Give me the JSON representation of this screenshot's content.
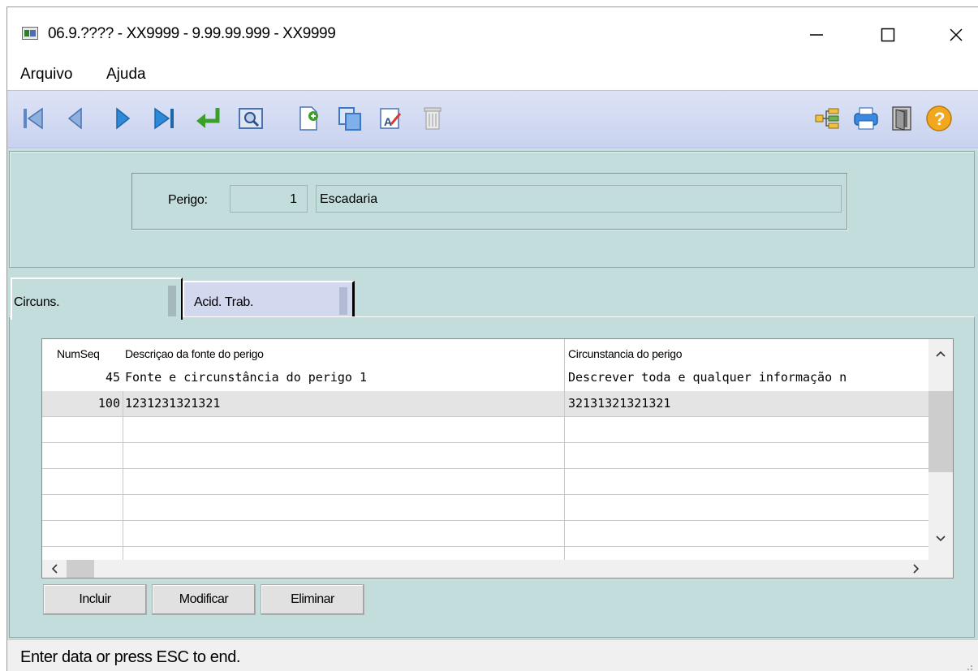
{
  "window": {
    "title": "06.9.???? - XX9999 - 9.99.99.999 - XX9999"
  },
  "menu": {
    "items": [
      {
        "label": "Arquivo"
      },
      {
        "label": "Ajuda"
      }
    ]
  },
  "toolbar": {
    "buttons": [
      {
        "icon": "first-record-icon"
      },
      {
        "icon": "previous-record-icon"
      },
      {
        "icon": "next-record-icon"
      },
      {
        "icon": "last-record-icon"
      },
      {
        "icon": "return-icon"
      },
      {
        "icon": "view-icon"
      },
      {
        "icon": "new-record-icon"
      },
      {
        "icon": "copy-icon"
      },
      {
        "icon": "edit-icon"
      },
      {
        "icon": "delete-icon"
      },
      {
        "icon": "tree-icon"
      },
      {
        "icon": "print-icon"
      },
      {
        "icon": "exit-door-icon"
      },
      {
        "icon": "help-icon"
      }
    ]
  },
  "header": {
    "perigo_label": "Perigo:",
    "perigo_number": "1",
    "perigo_description": "Escadaria"
  },
  "tabs": [
    {
      "label": "Circuns."
    },
    {
      "label": "Acid. Trab."
    }
  ],
  "grid": {
    "columns": [
      "NumSeq",
      "Descriçao da fonte do perigo",
      "Circunstancia do perigo"
    ],
    "rows": [
      {
        "numseq": "45",
        "descricao": "Fonte e circunstância do perigo 1",
        "circunstancia": "Descrever toda e qualquer informação n"
      },
      {
        "numseq": "100",
        "descricao": "1231231321321",
        "circunstancia": "32131321321321"
      }
    ]
  },
  "buttons": {
    "incluir": "Incluir",
    "modificar": "Modificar",
    "eliminar": "Eliminar"
  },
  "status": {
    "text": "Enter data or press ESC to end."
  }
}
